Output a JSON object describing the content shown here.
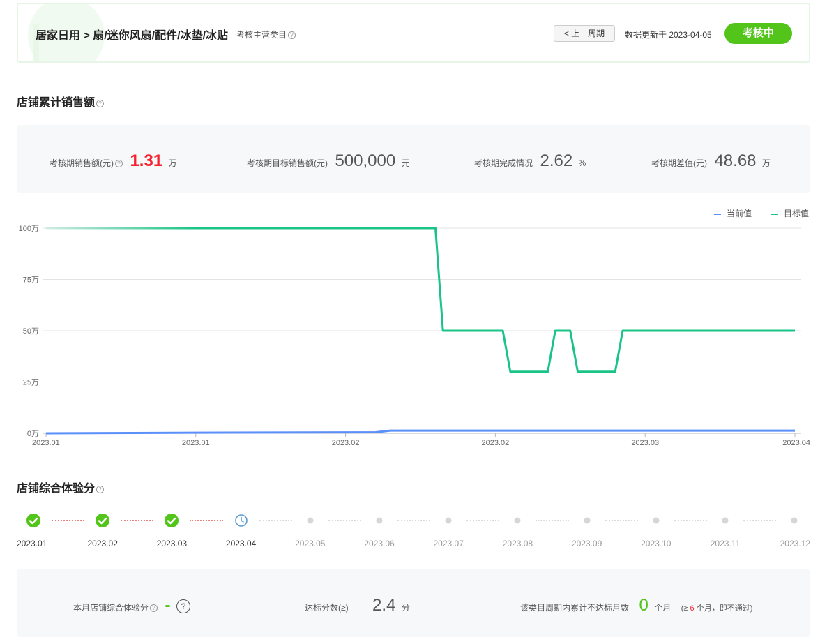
{
  "header": {
    "breadcrumb": "居家日用 > 扇/迷你风扇/配件/冰垫/冰贴",
    "main_category_label": "考核主营类目",
    "prev_period_button": "< 上一周期",
    "update_text": "数据更新于 2023-04-05",
    "status": "考核中"
  },
  "sales_section": {
    "title": "店铺累计销售额",
    "stats": [
      {
        "label": "考核期销售额(元)",
        "value": "1.31",
        "unit": "万"
      },
      {
        "label": "考核期目标销售额(元)",
        "value": "500,000",
        "unit": "元"
      },
      {
        "label": "考核期完成情况",
        "value": "2.62",
        "unit": "%"
      },
      {
        "label": "考核期差值(元)",
        "value": "48.68",
        "unit": "万"
      }
    ]
  },
  "chart_data": {
    "type": "line",
    "x": [
      "2023.01",
      "2023.01",
      "2023.02",
      "2023.02",
      "2023.03",
      "2023.04"
    ],
    "yticks": [
      "0万",
      "25万",
      "50万",
      "75万",
      "100万"
    ],
    "ylim": [
      0,
      100
    ],
    "series": [
      {
        "name": "当前值",
        "color": "#5b8ff9",
        "points": [
          [
            0,
            0
          ],
          [
            0.2,
            0.3
          ],
          [
            0.44,
            0.5
          ],
          [
            0.46,
            1.31
          ],
          [
            1.0,
            1.31
          ]
        ]
      },
      {
        "name": "目标值",
        "color": "#1ac486",
        "points": [
          [
            0,
            100
          ],
          [
            0.52,
            100
          ],
          [
            0.53,
            50
          ],
          [
            0.61,
            50
          ],
          [
            0.62,
            30
          ],
          [
            0.67,
            30
          ],
          [
            0.68,
            50
          ],
          [
            0.7,
            50
          ],
          [
            0.71,
            30
          ],
          [
            0.76,
            30
          ],
          [
            0.77,
            50
          ],
          [
            1.0,
            50
          ]
        ]
      }
    ]
  },
  "score_section": {
    "title": "店铺综合体验分",
    "timeline": [
      {
        "month": "2023.01",
        "state": "done"
      },
      {
        "month": "2023.02",
        "state": "done"
      },
      {
        "month": "2023.03",
        "state": "done"
      },
      {
        "month": "2023.04",
        "state": "current"
      },
      {
        "month": "2023.05",
        "state": "future"
      },
      {
        "month": "2023.06",
        "state": "future"
      },
      {
        "month": "2023.07",
        "state": "future"
      },
      {
        "month": "2023.08",
        "state": "future"
      },
      {
        "month": "2023.09",
        "state": "future"
      },
      {
        "month": "2023.10",
        "state": "future"
      },
      {
        "month": "2023.11",
        "state": "future"
      },
      {
        "month": "2023.12",
        "state": "future"
      }
    ],
    "stats": {
      "month_score_label": "本月店铺综合体验分",
      "month_score_value": "-",
      "target_label": "达标分数(≥)",
      "target_value": "2.4",
      "target_unit": "分",
      "fail_label": "该类目周期内累计不达标月数",
      "fail_value": "0",
      "fail_unit": "个月",
      "fail_note_prefix": "(≥ ",
      "fail_note_count": "6",
      "fail_note_suffix": " 个月，即不通过)"
    }
  },
  "colors": {
    "accent_green": "#52c41a",
    "red": "#f5222d",
    "line_blue": "#5b8ff9",
    "line_green": "#1ac486"
  }
}
